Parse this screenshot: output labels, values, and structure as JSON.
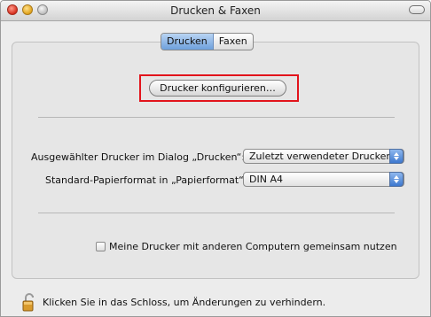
{
  "window": {
    "title": "Drucken & Faxen"
  },
  "tabs": {
    "items": [
      "Drucken",
      "Faxen"
    ],
    "selected": "Drucken"
  },
  "main": {
    "configure_button": "Drucker konfigurieren…",
    "selected_printer_label": "Ausgewählter Drucker im Dialog „Drucken“:",
    "selected_printer_value": "Zuletzt verwendeter Drucker",
    "paper_label": "Standard-Papierformat in „Papierformat“:",
    "paper_value": "DIN A4",
    "share_label": "Meine Drucker mit anderen Computern gemeinsam nutzen"
  },
  "footer": {
    "lock_text": "Klicken Sie in das Schloss, um Änderungen zu verhindern."
  },
  "colors": {
    "highlight": "#e2141c",
    "active_tab": "#6ea0dc"
  },
  "icons": {
    "lock": "lock-icon"
  }
}
